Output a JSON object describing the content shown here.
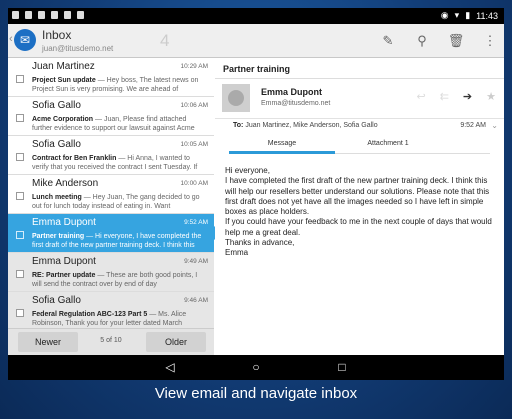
{
  "status_bar": {
    "time": "11:43"
  },
  "action_bar": {
    "back_glyph": "‹",
    "app_icon": "mail-icon",
    "title": "Inbox",
    "account": "juan@titusdemo.net",
    "count": "4",
    "actions": [
      "compose-icon",
      "search-icon",
      "trash-icon",
      "overflow-menu-icon"
    ]
  },
  "messages": [
    {
      "sender": "Juan Martinez",
      "subject": "Project Sun update",
      "preview": " — Hey boss, The latest news on Project Sun is very promising. We are ahead of",
      "time": "10:29 AM"
    },
    {
      "sender": "Sofia Gallo",
      "subject": "Acme Corporation",
      "preview": " — Juan, Please find attached further evidence to support our lawsuit against Acme",
      "time": "10:06 AM"
    },
    {
      "sender": "Sofia Gallo",
      "subject": "Contract for Ben Franklin",
      "preview": " — Hi Anna, I wanted to verify that you received the contract I sent Tuesday. If",
      "time": "10:05 AM"
    },
    {
      "sender": "Mike Anderson",
      "subject": "Lunch meeting",
      "preview": " — Hey Juan, The gang decided to go out for lunch today instead of eating in. Want",
      "time": "10:00 AM"
    },
    {
      "sender": "Emma Dupont",
      "subject": "Partner training",
      "preview": " — Hi everyone, I have completed the first draft of the new partner training deck. I think this",
      "time": "9:52 AM"
    },
    {
      "sender": "Emma Dupont",
      "subject": "RE: Partner update",
      "preview": " — These are both good points, I will send the contract over by end of day",
      "time": "9:49 AM"
    },
    {
      "sender": "Sofia Gallo",
      "subject": "Federal Regulation ABC-123 Part 5",
      "preview": " — Ms. Alice Robinson, Thank you for your letter dated March",
      "time": "9:46 AM"
    }
  ],
  "list_footer": {
    "newer": "Newer",
    "page": "5 of 10",
    "older": "Older"
  },
  "reading": {
    "subject": "Partner training",
    "from_name": "Emma Dupont",
    "from_email": "Emma@titusdemo.net",
    "to_label": "To:",
    "to_names": " Juan Martinez, Mike Anderson, Sofia Gallo",
    "time": "9:52 AM",
    "tabs": [
      "Message",
      "Attachment 1"
    ],
    "body": [
      "Hi everyone,",
      "I have completed the first draft of the new partner training deck. I think this will help our resellers better understand our solutions. Please note that this first draft does not yet have all the images needed so I have left in simple boxes as place holders.",
      "If you could have your feedback to me in the next couple of days that would help me a great deal.",
      "Thanks in advance,",
      "Emma"
    ]
  },
  "caption": "View email and navigate inbox",
  "colors": {
    "accent": "#36a4e0",
    "tab_underline": "#2b9ad8",
    "app_icon": "#1c6fc4",
    "background": "#123d77"
  }
}
